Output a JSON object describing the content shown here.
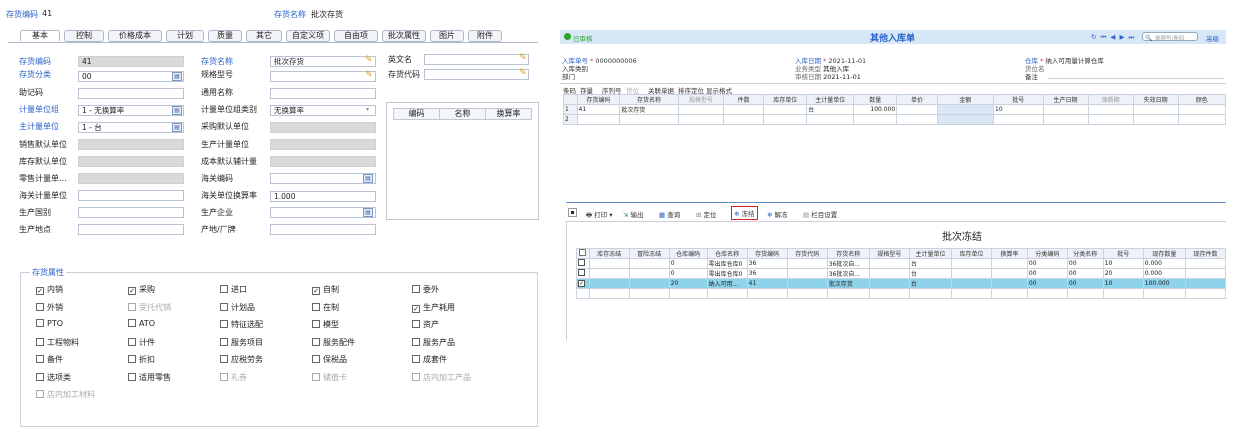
{
  "left": {
    "header_code_label": "存货编码",
    "header_code_value": "41",
    "header_name_label": "存货名称",
    "header_name_value": "批次存货",
    "tabs": [
      "基本",
      "控制",
      "价格成本",
      "计划",
      "质量",
      "其它",
      "自定义项",
      "自由项",
      "批次属性",
      "图片",
      "附件"
    ],
    "col1": {
      "code_label": "存货编码",
      "code_value": "41",
      "category_label": "存货分类",
      "category_value": "00",
      "mnemonic_label": "助记码",
      "uom_group_label": "计量单位组",
      "uom_group_value": "1 - 无换算率",
      "main_uom_label": "主计量单位",
      "main_uom_value": "1 - 台",
      "sales_uom_label": "销售默认单位",
      "stock_uom_label": "库存默认单位",
      "retail_uom_label": "零售计量单...",
      "customs_uom_label": "海关计量单位",
      "country_label": "生产国别",
      "origin_label": "生产地点"
    },
    "col2": {
      "name_label": "存货名称",
      "name_value": "批次存货",
      "spec_label": "规格型号",
      "common_name_label": "通用名称",
      "uom_group_type_label": "计量单位组类别",
      "uom_group_type_value": "无换算率",
      "purchase_uom_label": "采购默认单位",
      "production_uom_label": "生产计量单位",
      "cost_uom_label": "成本默认辅计量",
      "customs_code_label": "海关编码",
      "customs_rate_label": "海关单位换算率",
      "customs_rate_value": "1.000",
      "manufacturer_label": "生产企业",
      "brand_label": "产地/厂牌"
    },
    "col3": {
      "english_name_label": "英文名",
      "inv_code_label": "存货代码",
      "grid_headers": [
        "编码",
        "名称",
        "换算率"
      ]
    },
    "attrs_title": "存货属性",
    "attrs": [
      [
        "内销",
        "采购",
        "进口",
        "自制",
        "委外"
      ],
      [
        "外销",
        "受托代销",
        "计划品",
        "在制",
        "生产耗用"
      ],
      [
        "PTO",
        "ATO",
        "特征选配",
        "模型",
        "资产"
      ],
      [
        "工程物料",
        "计件",
        "服务项目",
        "服务配件",
        "服务产品"
      ],
      [
        "备件",
        "折扣",
        "应税劳务",
        "保税品",
        "成套件"
      ],
      [
        "选项类",
        "适用零售",
        "礼券",
        "储值卡",
        "店内加工产品"
      ],
      [
        "店内加工材料"
      ]
    ],
    "attrs_checked": [
      [
        true,
        true,
        false,
        true,
        false
      ],
      [
        false,
        false,
        false,
        false,
        true
      ],
      [
        false,
        false,
        false,
        false,
        false
      ],
      [
        false,
        false,
        false,
        false,
        false
      ],
      [
        false,
        false,
        false,
        false,
        false
      ],
      [
        false,
        false,
        false,
        false,
        false
      ],
      [
        false
      ]
    ],
    "attrs_disabled": [
      [
        false,
        false,
        false,
        false,
        false
      ],
      [
        false,
        true,
        false,
        false,
        false
      ],
      [
        false,
        false,
        false,
        false,
        false
      ],
      [
        false,
        false,
        false,
        false,
        false
      ],
      [
        false,
        false,
        false,
        false,
        false
      ],
      [
        false,
        false,
        true,
        true,
        true
      ],
      [
        true
      ]
    ]
  },
  "top_right": {
    "status": "已审核",
    "title": "其他入库单",
    "search_placeholder": "单据号/条码",
    "advanced": "高级",
    "nav_icons": "↻  ⏮  ◀  ▶  ⏭",
    "fields": {
      "doc_no_label": "入库单号",
      "doc_no_value": "0000000006",
      "date_label": "入库日期",
      "date_value": "2021-11-01",
      "warehouse_label": "仓库",
      "warehouse_value": "纳入可用量计算仓库",
      "category_label": "入库类别",
      "biz_type_label": "业务类型",
      "biz_type_value": "其他入库",
      "location_label": "货位名",
      "dept_label": "部门",
      "audit_date_label": "审核日期",
      "audit_date_value": "2021-11-01",
      "remark_label": "备注"
    },
    "toolbar": [
      "条码",
      "存量",
      "序列号",
      "货位",
      "关联单据",
      "排序定位",
      "显示格式"
    ],
    "columns": [
      "",
      "存货编码",
      "存货名称",
      "规格型号",
      "件数",
      "库存单位",
      "主计量单位",
      "数量",
      "单价",
      "金额",
      "批号",
      "生产日期",
      "保质期",
      "失效日期",
      "颜色"
    ],
    "rows": [
      [
        "1",
        "41",
        "批次存货",
        "",
        "",
        "",
        "台",
        "100.000",
        "",
        "",
        "10",
        "",
        "",
        "",
        ""
      ],
      [
        "2",
        "",
        "",
        "",
        "",
        "",
        "",
        "",
        "",
        "",
        "",
        "",
        "",
        "",
        ""
      ]
    ]
  },
  "bottom_right": {
    "toolbar": {
      "print": "打印",
      "export": "输出",
      "query": "查询",
      "locate": "定位",
      "freeze": "冻结",
      "unfreeze": "解冻",
      "column_settings": "栏目设置"
    },
    "title": "批次冻结",
    "columns": [
      "",
      "库存冻结",
      "冒险冻结",
      "仓库编码",
      "仓库名称",
      "存货编码",
      "存货代码",
      "存货名称",
      "规格型号",
      "主计量单位",
      "库存单位",
      "换算率",
      "分类编码",
      "分类名称",
      "批号",
      "现存数量",
      "现存件数"
    ],
    "rows": [
      [
        "",
        "",
        "",
        "0",
        "零出库仓库0",
        "36",
        "",
        "36批次自...",
        "",
        "台",
        "",
        "",
        "00",
        "00",
        "10",
        "0.000",
        ""
      ],
      [
        "",
        "",
        "",
        "0",
        "零出库仓库0",
        "36",
        "",
        "36批次自...",
        "",
        "台",
        "",
        "",
        "00",
        "00",
        "20",
        "0.000",
        ""
      ],
      [
        "✓",
        "",
        "",
        "20",
        "纳入可用...",
        "41",
        "",
        "批次存货",
        "",
        "台",
        "",
        "",
        "00",
        "00",
        "10",
        "100.000",
        ""
      ]
    ],
    "selected_row": 2
  }
}
